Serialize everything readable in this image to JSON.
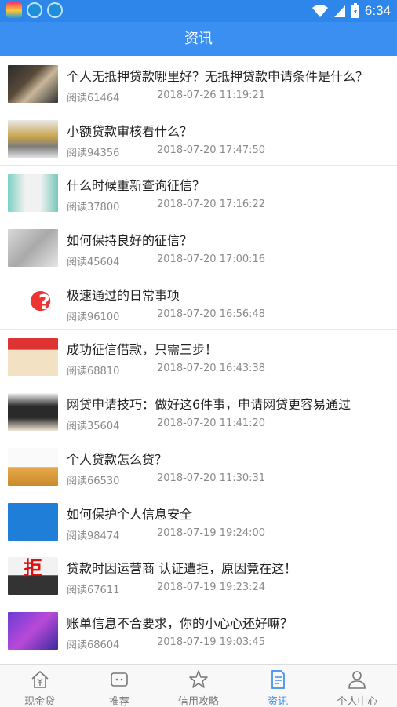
{
  "statusbar": {
    "time": "6:34"
  },
  "appbar": {
    "title": "资讯"
  },
  "articles": [
    {
      "title": "个人无抵押贷款哪里好？无抵押贷款申请条件是什么？",
      "reads": "阅读61464",
      "date": "2018-07-26 11:19:21"
    },
    {
      "title": "小额贷款审核看什么？",
      "reads": "阅读94356",
      "date": "2018-07-20 17:47:50"
    },
    {
      "title": "什么时候重新查询征信？",
      "reads": "阅读37800",
      "date": "2018-07-20 17:16:22"
    },
    {
      "title": "如何保持良好的征信？",
      "reads": "阅读45604",
      "date": "2018-07-20 17:00:16"
    },
    {
      "title": "极速通过的日常事项",
      "reads": "阅读96100",
      "date": "2018-07-20 16:56:48"
    },
    {
      "title": "成功征信借款，只需三步！",
      "reads": "阅读68810",
      "date": "2018-07-20 16:43:38"
    },
    {
      "title": "网贷申请技巧：做好这6件事，申请网贷更容易通过",
      "reads": "阅读35604",
      "date": "2018-07-20 11:41:20"
    },
    {
      "title": "个人贷款怎么贷？",
      "reads": "阅读66530",
      "date": "2018-07-20 11:30:31"
    },
    {
      "title": "如何保护个人信息安全",
      "reads": "阅读98474",
      "date": "2018-07-19 19:24:00"
    },
    {
      "title": "贷款时因运营商 认证遭拒，原因竟在这！",
      "reads": "阅读67611",
      "date": "2018-07-19 19:23:24"
    },
    {
      "title": "账单信息不合要求，你的小心心还好嘛？",
      "reads": "阅读68604",
      "date": "2018-07-19 19:03:45"
    }
  ],
  "thumb_text": {
    "t4": "?",
    "t9": "拒"
  },
  "tabs": [
    {
      "label": "现金贷"
    },
    {
      "label": "推荐"
    },
    {
      "label": "信用攻略"
    },
    {
      "label": "资讯"
    },
    {
      "label": "个人中心"
    }
  ],
  "colors": {
    "primary": "#3a8ff0",
    "statusbar": "#2f86ea"
  }
}
